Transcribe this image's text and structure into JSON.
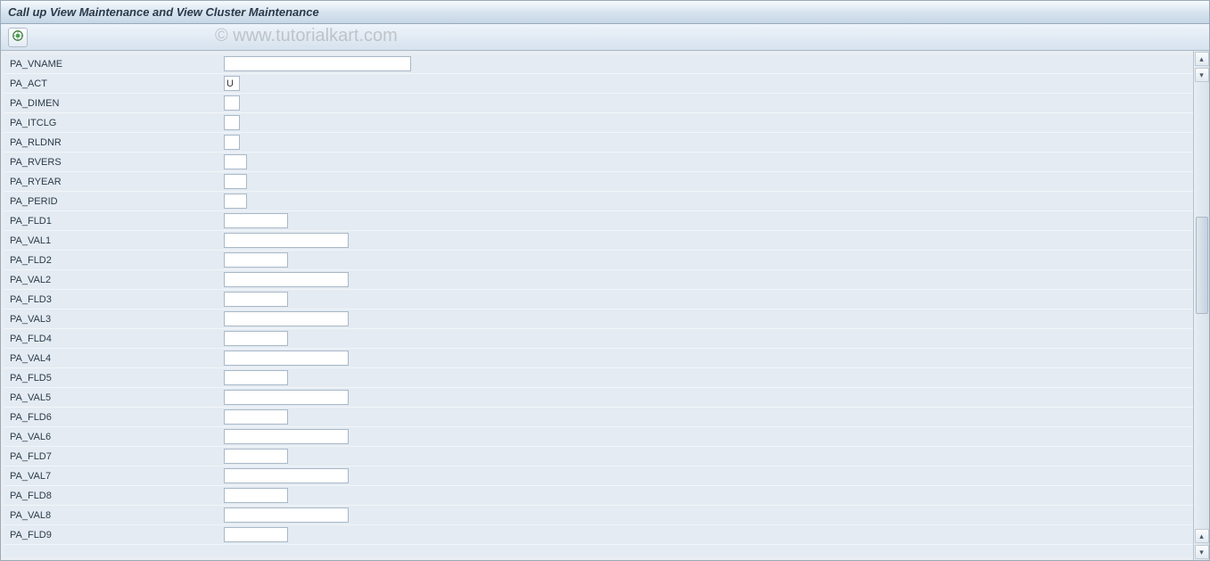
{
  "window": {
    "title": "Call up View Maintenance and View Cluster Maintenance"
  },
  "toolbar": {
    "execute_tooltip": "Execute"
  },
  "watermark": "© www.tutorialkart.com",
  "fields": [
    {
      "name": "PA_VNAME",
      "width": "xwide",
      "value": ""
    },
    {
      "name": "PA_ACT",
      "width": "tiny",
      "value": "U"
    },
    {
      "name": "PA_DIMEN",
      "width": "tiny",
      "value": ""
    },
    {
      "name": "PA_ITCLG",
      "width": "tiny",
      "value": ""
    },
    {
      "name": "PA_RLDNR",
      "width": "tiny",
      "value": ""
    },
    {
      "name": "PA_RVERS",
      "width": "small",
      "value": ""
    },
    {
      "name": "PA_RYEAR",
      "width": "small",
      "value": ""
    },
    {
      "name": "PA_PERID",
      "width": "small",
      "value": ""
    },
    {
      "name": "PA_FLD1",
      "width": "med",
      "value": ""
    },
    {
      "name": "PA_VAL1",
      "width": "wide",
      "value": ""
    },
    {
      "name": "PA_FLD2",
      "width": "med",
      "value": ""
    },
    {
      "name": "PA_VAL2",
      "width": "wide",
      "value": ""
    },
    {
      "name": "PA_FLD3",
      "width": "med",
      "value": ""
    },
    {
      "name": "PA_VAL3",
      "width": "wide",
      "value": ""
    },
    {
      "name": "PA_FLD4",
      "width": "med",
      "value": ""
    },
    {
      "name": "PA_VAL4",
      "width": "wide",
      "value": ""
    },
    {
      "name": "PA_FLD5",
      "width": "med",
      "value": ""
    },
    {
      "name": "PA_VAL5",
      "width": "wide",
      "value": ""
    },
    {
      "name": "PA_FLD6",
      "width": "med",
      "value": ""
    },
    {
      "name": "PA_VAL6",
      "width": "wide",
      "value": ""
    },
    {
      "name": "PA_FLD7",
      "width": "med",
      "value": ""
    },
    {
      "name": "PA_VAL7",
      "width": "wide",
      "value": ""
    },
    {
      "name": "PA_FLD8",
      "width": "med",
      "value": ""
    },
    {
      "name": "PA_VAL8",
      "width": "wide",
      "value": ""
    },
    {
      "name": "PA_FLD9",
      "width": "med",
      "value": ""
    }
  ]
}
